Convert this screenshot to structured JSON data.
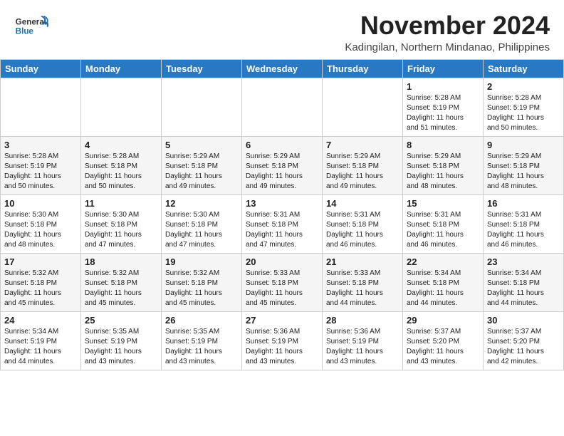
{
  "header": {
    "logo_text_general": "General",
    "logo_text_blue": "Blue",
    "month": "November 2024",
    "location": "Kadingilan, Northern Mindanao, Philippines"
  },
  "days_of_week": [
    "Sunday",
    "Monday",
    "Tuesday",
    "Wednesday",
    "Thursday",
    "Friday",
    "Saturday"
  ],
  "weeks": [
    [
      {
        "day": "",
        "info": ""
      },
      {
        "day": "",
        "info": ""
      },
      {
        "day": "",
        "info": ""
      },
      {
        "day": "",
        "info": ""
      },
      {
        "day": "",
        "info": ""
      },
      {
        "day": "1",
        "info": "Sunrise: 5:28 AM\nSunset: 5:19 PM\nDaylight: 11 hours\nand 51 minutes."
      },
      {
        "day": "2",
        "info": "Sunrise: 5:28 AM\nSunset: 5:19 PM\nDaylight: 11 hours\nand 50 minutes."
      }
    ],
    [
      {
        "day": "3",
        "info": "Sunrise: 5:28 AM\nSunset: 5:19 PM\nDaylight: 11 hours\nand 50 minutes."
      },
      {
        "day": "4",
        "info": "Sunrise: 5:28 AM\nSunset: 5:18 PM\nDaylight: 11 hours\nand 50 minutes."
      },
      {
        "day": "5",
        "info": "Sunrise: 5:29 AM\nSunset: 5:18 PM\nDaylight: 11 hours\nand 49 minutes."
      },
      {
        "day": "6",
        "info": "Sunrise: 5:29 AM\nSunset: 5:18 PM\nDaylight: 11 hours\nand 49 minutes."
      },
      {
        "day": "7",
        "info": "Sunrise: 5:29 AM\nSunset: 5:18 PM\nDaylight: 11 hours\nand 49 minutes."
      },
      {
        "day": "8",
        "info": "Sunrise: 5:29 AM\nSunset: 5:18 PM\nDaylight: 11 hours\nand 48 minutes."
      },
      {
        "day": "9",
        "info": "Sunrise: 5:29 AM\nSunset: 5:18 PM\nDaylight: 11 hours\nand 48 minutes."
      }
    ],
    [
      {
        "day": "10",
        "info": "Sunrise: 5:30 AM\nSunset: 5:18 PM\nDaylight: 11 hours\nand 48 minutes."
      },
      {
        "day": "11",
        "info": "Sunrise: 5:30 AM\nSunset: 5:18 PM\nDaylight: 11 hours\nand 47 minutes."
      },
      {
        "day": "12",
        "info": "Sunrise: 5:30 AM\nSunset: 5:18 PM\nDaylight: 11 hours\nand 47 minutes."
      },
      {
        "day": "13",
        "info": "Sunrise: 5:31 AM\nSunset: 5:18 PM\nDaylight: 11 hours\nand 47 minutes."
      },
      {
        "day": "14",
        "info": "Sunrise: 5:31 AM\nSunset: 5:18 PM\nDaylight: 11 hours\nand 46 minutes."
      },
      {
        "day": "15",
        "info": "Sunrise: 5:31 AM\nSunset: 5:18 PM\nDaylight: 11 hours\nand 46 minutes."
      },
      {
        "day": "16",
        "info": "Sunrise: 5:31 AM\nSunset: 5:18 PM\nDaylight: 11 hours\nand 46 minutes."
      }
    ],
    [
      {
        "day": "17",
        "info": "Sunrise: 5:32 AM\nSunset: 5:18 PM\nDaylight: 11 hours\nand 45 minutes."
      },
      {
        "day": "18",
        "info": "Sunrise: 5:32 AM\nSunset: 5:18 PM\nDaylight: 11 hours\nand 45 minutes."
      },
      {
        "day": "19",
        "info": "Sunrise: 5:32 AM\nSunset: 5:18 PM\nDaylight: 11 hours\nand 45 minutes."
      },
      {
        "day": "20",
        "info": "Sunrise: 5:33 AM\nSunset: 5:18 PM\nDaylight: 11 hours\nand 45 minutes."
      },
      {
        "day": "21",
        "info": "Sunrise: 5:33 AM\nSunset: 5:18 PM\nDaylight: 11 hours\nand 44 minutes."
      },
      {
        "day": "22",
        "info": "Sunrise: 5:34 AM\nSunset: 5:18 PM\nDaylight: 11 hours\nand 44 minutes."
      },
      {
        "day": "23",
        "info": "Sunrise: 5:34 AM\nSunset: 5:18 PM\nDaylight: 11 hours\nand 44 minutes."
      }
    ],
    [
      {
        "day": "24",
        "info": "Sunrise: 5:34 AM\nSunset: 5:19 PM\nDaylight: 11 hours\nand 44 minutes."
      },
      {
        "day": "25",
        "info": "Sunrise: 5:35 AM\nSunset: 5:19 PM\nDaylight: 11 hours\nand 43 minutes."
      },
      {
        "day": "26",
        "info": "Sunrise: 5:35 AM\nSunset: 5:19 PM\nDaylight: 11 hours\nand 43 minutes."
      },
      {
        "day": "27",
        "info": "Sunrise: 5:36 AM\nSunset: 5:19 PM\nDaylight: 11 hours\nand 43 minutes."
      },
      {
        "day": "28",
        "info": "Sunrise: 5:36 AM\nSunset: 5:19 PM\nDaylight: 11 hours\nand 43 minutes."
      },
      {
        "day": "29",
        "info": "Sunrise: 5:37 AM\nSunset: 5:20 PM\nDaylight: 11 hours\nand 43 minutes."
      },
      {
        "day": "30",
        "info": "Sunrise: 5:37 AM\nSunset: 5:20 PM\nDaylight: 11 hours\nand 42 minutes."
      }
    ]
  ]
}
